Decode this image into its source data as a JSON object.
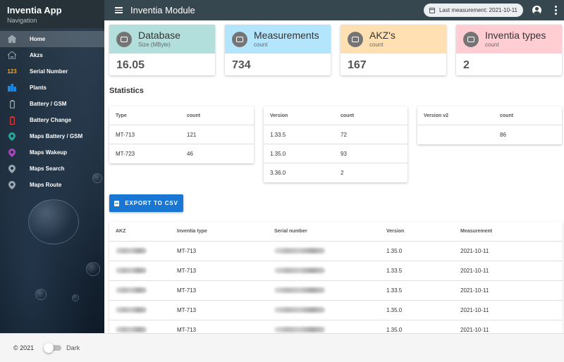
{
  "app": {
    "title": "Inventia App",
    "subtitle": "Navigation"
  },
  "sidebar": {
    "items": [
      {
        "label": "Home",
        "icon": "home-icon",
        "active": true,
        "color": "#9aa5ad"
      },
      {
        "label": "Akzs",
        "icon": "house-outline-icon",
        "active": false,
        "color": "#9aa5ad"
      },
      {
        "label": "Serial Number",
        "icon": "123-icon",
        "active": false,
        "color": "#f9a825"
      },
      {
        "label": "Plants",
        "icon": "buildings-icon",
        "active": false,
        "color": "#1e88e5"
      },
      {
        "label": "Battery / GSM",
        "icon": "battery-icon",
        "active": false,
        "color": "#9aa5ad"
      },
      {
        "label": "Battery Change",
        "icon": "battery-alert-icon",
        "active": false,
        "color": "#e53935"
      },
      {
        "label": "Maps Battery / GSM",
        "icon": "map-marker-icon",
        "active": false,
        "color": "#26a69a"
      },
      {
        "label": "Maps Wakeup",
        "icon": "map-marker-icon",
        "active": false,
        "color": "#ab47bc"
      },
      {
        "label": "Maps Search",
        "icon": "map-marker-icon",
        "active": false,
        "color": "#9aa5ad"
      },
      {
        "label": "Maps Route",
        "icon": "map-marker-icon",
        "active": false,
        "color": "#9aa5ad"
      }
    ]
  },
  "topbar": {
    "title": "Inventia Module",
    "last_measurement": "Last measurement: 2021-10-11"
  },
  "stats": [
    {
      "title": "Database",
      "subtitle": "Size (MByte)",
      "value": "16.05",
      "color": "#b2dfdb",
      "icon": "database-icon"
    },
    {
      "title": "Measurements",
      "subtitle": "count",
      "value": "734",
      "color": "#b3e5fc",
      "icon": "measurement-icon"
    },
    {
      "title": "AKZ's",
      "subtitle": "count",
      "value": "167",
      "color": "#ffe0b2",
      "icon": "akz-icon"
    },
    {
      "title": "Inventia types",
      "subtitle": "count",
      "value": "2",
      "color": "#ffcdd2",
      "icon": "types-icon"
    }
  ],
  "statistics": {
    "title": "Statistics",
    "type_table": {
      "headers": [
        "Type",
        "count"
      ],
      "rows": [
        [
          "MT-713",
          "121"
        ],
        [
          "MT-723",
          "46"
        ]
      ]
    },
    "version_table": {
      "headers": [
        "Version",
        "count"
      ],
      "rows": [
        [
          "1.33.5",
          "72"
        ],
        [
          "1.35.0",
          "93"
        ],
        [
          "3.36.0",
          "2"
        ]
      ]
    },
    "version2_table": {
      "headers": [
        "Version v2",
        "count"
      ],
      "rows": [
        [
          "",
          "86"
        ]
      ]
    }
  },
  "export": {
    "label": "EXPORT TO CSV"
  },
  "table": {
    "headers": [
      "AKZ",
      "Inventia type",
      "Serial number",
      "Version",
      "Measurement"
    ],
    "rows": [
      {
        "type": "MT-713",
        "version": "1.35.0",
        "measurement": "2021-10-11"
      },
      {
        "type": "MT-713",
        "version": "1.33.5",
        "measurement": "2021-10-11"
      },
      {
        "type": "MT-713",
        "version": "1.33.5",
        "measurement": "2021-10-11"
      },
      {
        "type": "MT-713",
        "version": "1.35.0",
        "measurement": "2021-10-11"
      },
      {
        "type": "MT-713",
        "version": "1.35.0",
        "measurement": "2021-10-11"
      }
    ]
  },
  "footer": {
    "copyright": "© 2021",
    "dark_label": "Dark"
  }
}
